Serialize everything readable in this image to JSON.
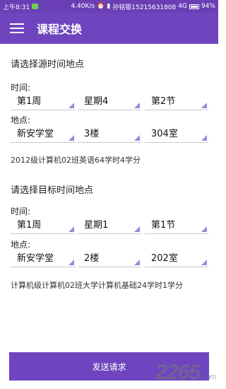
{
  "status_bar": {
    "time": "上午8:31",
    "net_speed": "4.40K/s",
    "carrier": "孙铭锟15215631808",
    "network": "4G",
    "battery": "94%"
  },
  "app_bar": {
    "title": "课程交换",
    "menu_icon": "menu-icon"
  },
  "source": {
    "heading": "请选择源时间地点",
    "time_label": "时间:",
    "week": "第1周",
    "weekday": "星期4",
    "period": "第2节",
    "place_label": "地点:",
    "campus": "新安学堂",
    "floor": "3楼",
    "room": "304室",
    "course_info": "2012级计算机02班英语64学时4学分"
  },
  "target": {
    "heading": "请选择目标时间地点",
    "time_label": "时间:",
    "week": "第1周",
    "weekday": "星期1",
    "period": "第1节",
    "place_label": "地点:",
    "campus": "新安学堂",
    "floor": "2楼",
    "room": "202室",
    "course_info": "计算机级计算机02班大学计算机基础24学时1学分"
  },
  "actions": {
    "send_label": "发送请求"
  },
  "watermark": {
    "brand": "2265",
    "sub": ".com"
  },
  "colors": {
    "accent": "#6e45bf",
    "spinner_triangle": "#9f86d4"
  }
}
